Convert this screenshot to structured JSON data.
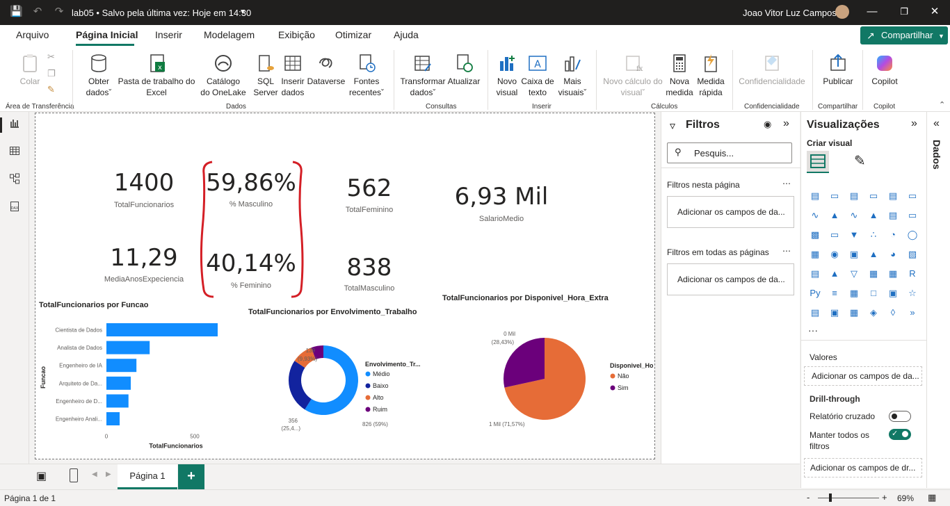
{
  "titlebar": {
    "title": "lab05 • Salvo pela última vez: Hoje em 14:30",
    "user": "Joao Vitor Luz Campos"
  },
  "menu": {
    "tabs": [
      "Arquivo",
      "Página Inicial",
      "Inserir",
      "Modelagem",
      "Exibição",
      "Otimizar",
      "Ajuda"
    ],
    "active": "Página Inicial",
    "share_label": "Compartilhar"
  },
  "ribbon": {
    "clipboard": {
      "paste": "Colar",
      "group": "Área de Transferência"
    },
    "data": {
      "get_data_1": "Obter",
      "get_data_2": "dados",
      "excel_1": "Pasta de trabalho do",
      "excel_2": "Excel",
      "onelake_1": "Catálogo",
      "onelake_2": "do OneLake",
      "sql_1": "SQL",
      "sql_2": "Server",
      "enter_1": "Inserir",
      "enter_2": "dados",
      "dataverse": "Dataverse",
      "recent_1": "Fontes",
      "recent_2": "recentes",
      "group": "Dados"
    },
    "queries": {
      "transform_1": "Transformar",
      "transform_2": "dados",
      "refresh": "Atualizar",
      "group": "Consultas"
    },
    "insert": {
      "newvisual_1": "Novo",
      "newvisual_2": "visual",
      "textbox_1": "Caixa de",
      "textbox_2": "texto",
      "more_1": "Mais",
      "more_2": "visuais",
      "group": "Inserir"
    },
    "calc": {
      "newcalc_1": "Novo cálculo do",
      "newcalc_2": "visual",
      "newmeasure_1": "Nova",
      "newmeasure_2": "medida",
      "quick_1": "Medida",
      "quick_2": "rápida",
      "group": "Cálculos"
    },
    "sensitivity": {
      "label": "Confidencialidade",
      "group": "Confidencialidade"
    },
    "share": {
      "publish": "Publicar",
      "group": "Compartilhar"
    },
    "copilot": {
      "label": "Copilot",
      "group": "Copilot"
    }
  },
  "leftnav": {
    "tooltip": "Exibição de relatório"
  },
  "cards": [
    {
      "value": "1400",
      "label": "TotalFuncionarios"
    },
    {
      "value": "59,86%",
      "label": "% Masculino"
    },
    {
      "value": "562",
      "label": "TotalFeminino"
    },
    {
      "value": "6,93 Mil",
      "label": "SalarioMedio"
    },
    {
      "value": "11,29",
      "label": "MediaAnosExpeciencia"
    },
    {
      "value": "40,14%",
      "label": "% Feminino"
    },
    {
      "value": "838",
      "label": "TotalMasculino"
    }
  ],
  "chart_data": [
    {
      "type": "bar",
      "title": "TotalFuncionarios por Funcao",
      "xlabel": "TotalFuncionarios",
      "ylabel": "Funcao",
      "categories": [
        "Cientista de Dados",
        "Analista de Dados",
        "Engenheiro de IA",
        "Arquiteto de Da...",
        "Engenheiro de D...",
        "Engenheiro Anali..."
      ],
      "values": [
        630,
        245,
        170,
        138,
        125,
        75
      ],
      "xlim": [
        0,
        630
      ],
      "xticks": [
        "0",
        "500"
      ],
      "color": "#118dff"
    },
    {
      "type": "pie",
      "donut": true,
      "title": "TotalFuncionarios por Envolvimento_Trabalho",
      "legend_title": "Envolvimento_Tr...",
      "categories": [
        "Médio",
        "Baixo",
        "Alto",
        "Ruim"
      ],
      "values": [
        826,
        356,
        139,
        79
      ],
      "colors": [
        "#118dff",
        "#12239e",
        "#e66c37",
        "#6b007b"
      ],
      "data_labels": [
        "826 (59%)",
        "356",
        "(25,4...)",
        "139",
        "(9,93%)"
      ]
    },
    {
      "type": "pie",
      "title": "TotalFuncionarios por Disponivel_Hora_Extra",
      "legend_title": "Disponivel_Hora_E...",
      "categories": [
        "Não",
        "Sim"
      ],
      "values": [
        1002,
        398
      ],
      "colors": [
        "#e66c37",
        "#6b007b"
      ],
      "data_labels": [
        "1 Mil (71,57%)",
        "0 Mil",
        "(28,43%)"
      ]
    }
  ],
  "filters": {
    "title": "Filtros",
    "search_placeholder": "Pesquis...",
    "page_section": "Filtros nesta página",
    "page_add": "Adicionar os campos de da...",
    "all_section": "Filtros em todas as páginas",
    "all_add": "Adicionar os campos de da..."
  },
  "visualizations": {
    "title": "Visualizações",
    "build": "Criar visual",
    "values_label": "Valores",
    "values_add": "Adicionar os campos de da...",
    "drill": "Drill-through",
    "cross_report": "Relatório cruzado",
    "keep_filters_1": "Manter todos os",
    "keep_filters_2": "filtros",
    "drill_add": "Adicionar os campos de dr...",
    "more": "···"
  },
  "data_pane": {
    "label": "Dados"
  },
  "pages": {
    "tab": "Página 1",
    "add": "+"
  },
  "status": {
    "page": "Página 1 de 1",
    "zoom": "69%",
    "minus": "-",
    "plus": "+"
  }
}
